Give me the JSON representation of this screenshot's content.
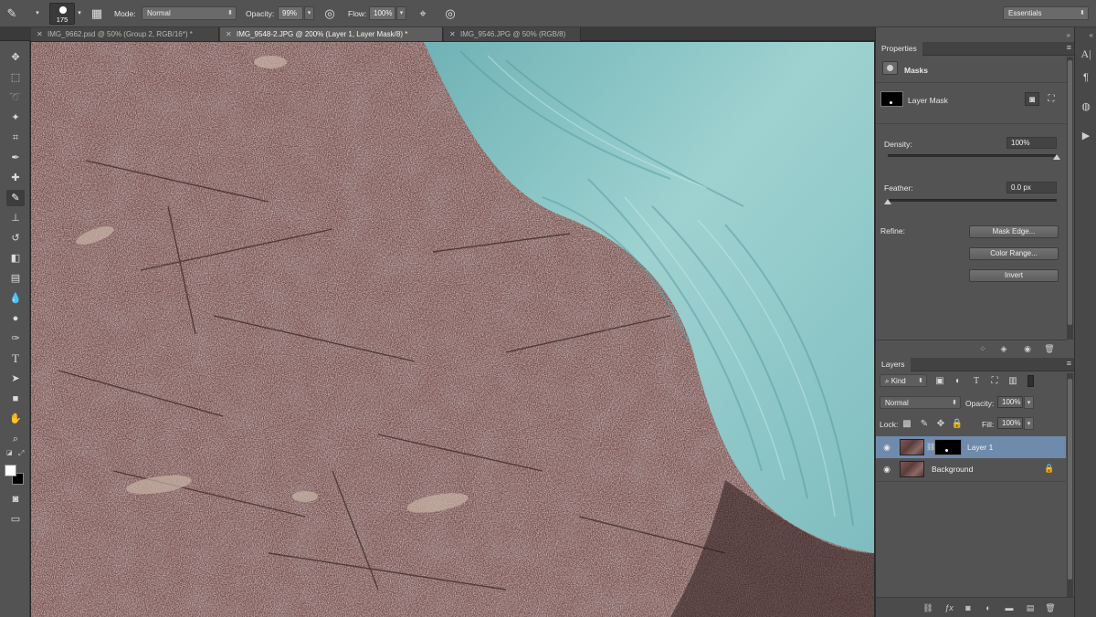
{
  "options_bar": {
    "brush_size": "175",
    "mode_label": "Mode:",
    "mode_value": "Normal",
    "opacity_label": "Opacity:",
    "opacity_value": "99%",
    "flow_label": "Flow:",
    "flow_value": "100%",
    "workspace": "Essentials"
  },
  "tabs": [
    {
      "label": "IMG_9662.psd @ 50% (Group 2, RGB/16*) *",
      "active": false
    },
    {
      "label": "IMG_9548-2.JPG @ 200% (Layer 1, Layer Mask/8) *",
      "active": true
    },
    {
      "label": "IMG_9546.JPG @ 50% (RGB/8)",
      "active": false
    }
  ],
  "toolbar": {
    "tools": [
      "move-icon",
      "marquee-icon",
      "lasso-icon",
      "quick-select-icon",
      "crop-icon",
      "eyedropper-icon",
      "healing-icon",
      "brush-icon",
      "stamp-icon",
      "history-brush-icon",
      "eraser-icon",
      "gradient-icon",
      "blur-icon",
      "dodge-icon",
      "pen-icon",
      "type-icon",
      "path-select-icon",
      "rectangle-icon",
      "hand-icon",
      "zoom-icon"
    ],
    "active_tool": "brush-icon",
    "foreground_color": "#ffffff",
    "background_color": "#000000"
  },
  "properties": {
    "tab": "Properties",
    "section": "Masks",
    "mask_name": "Layer Mask",
    "density_label": "Density:",
    "density_value": "100%",
    "density_level": 1.0,
    "feather_label": "Feather:",
    "feather_value": "0.0 px",
    "feather_level": 0.0,
    "refine_label": "Refine:",
    "mask_edge_button": "Mask Edge...",
    "color_range_button": "Color Range...",
    "invert_button": "Invert"
  },
  "layers": {
    "tab": "Layers",
    "filter_kind": "Kind",
    "blend_mode": "Normal",
    "opacity_label": "Opacity:",
    "opacity_value": "100%",
    "lock_label": "Lock:",
    "fill_label": "Fill:",
    "fill_value": "100%",
    "items": [
      {
        "name": "Layer 1",
        "selected": true,
        "has_mask": true,
        "locked": false
      },
      {
        "name": "Background",
        "selected": false,
        "has_mask": false,
        "locked": true
      }
    ]
  },
  "colors": {
    "accent_selected_layer": "#6e8aad",
    "panel_bg": "#535353",
    "canvas_ground": "#6e4a48",
    "fabric": "#8fc6c6"
  }
}
